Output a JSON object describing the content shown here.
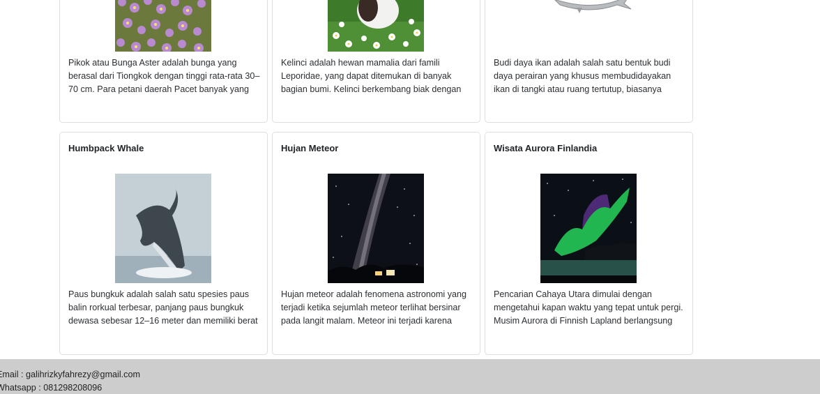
{
  "cards_top": [
    {
      "text": "Pikok atau Bunga Aster adalah bunga yang berasal dari Tiongkok dengan tinggi rata-rata 30–70 cm. Para petani daerah Pacet banyak yang"
    },
    {
      "text": "Kelinci adalah hewan mamalia dari famili Leporidae, yang dapat ditemukan di banyak bagian bumi. Kelinci berkembang biak dengan"
    },
    {
      "text": "Budi daya ikan adalah salah satu bentuk budi daya perairan yang khusus membudidayakan ikan di tangki atau ruang tertutup, biasanya"
    }
  ],
  "cards_bottom": [
    {
      "title": "Humbpack Whale",
      "text": "Paus bungkuk adalah salah satu spesies paus balin rorkual terbesar, panjang paus bungkuk dewasa sebesar 12–16 meter dan memiliki berat"
    },
    {
      "title": "Hujan Meteor",
      "text": "Hujan meteor adalah fenomena astronomi yang terjadi ketika sejumlah meteor terlihat bersinar pada langit malam. Meteor ini terjadi karena"
    },
    {
      "title": "Wisata Aurora Finlandia",
      "text": "Pencarian Cahaya Utara dimulai dengan mengetahui kapan waktu yang tepat untuk pergi. Musim Aurora di Finnish Lapland berlangsung"
    }
  ],
  "footer": {
    "email": "Email : galihrizkyfahrezy@gmail.com",
    "whatsapp": "Whatsapp : 081298208096"
  }
}
